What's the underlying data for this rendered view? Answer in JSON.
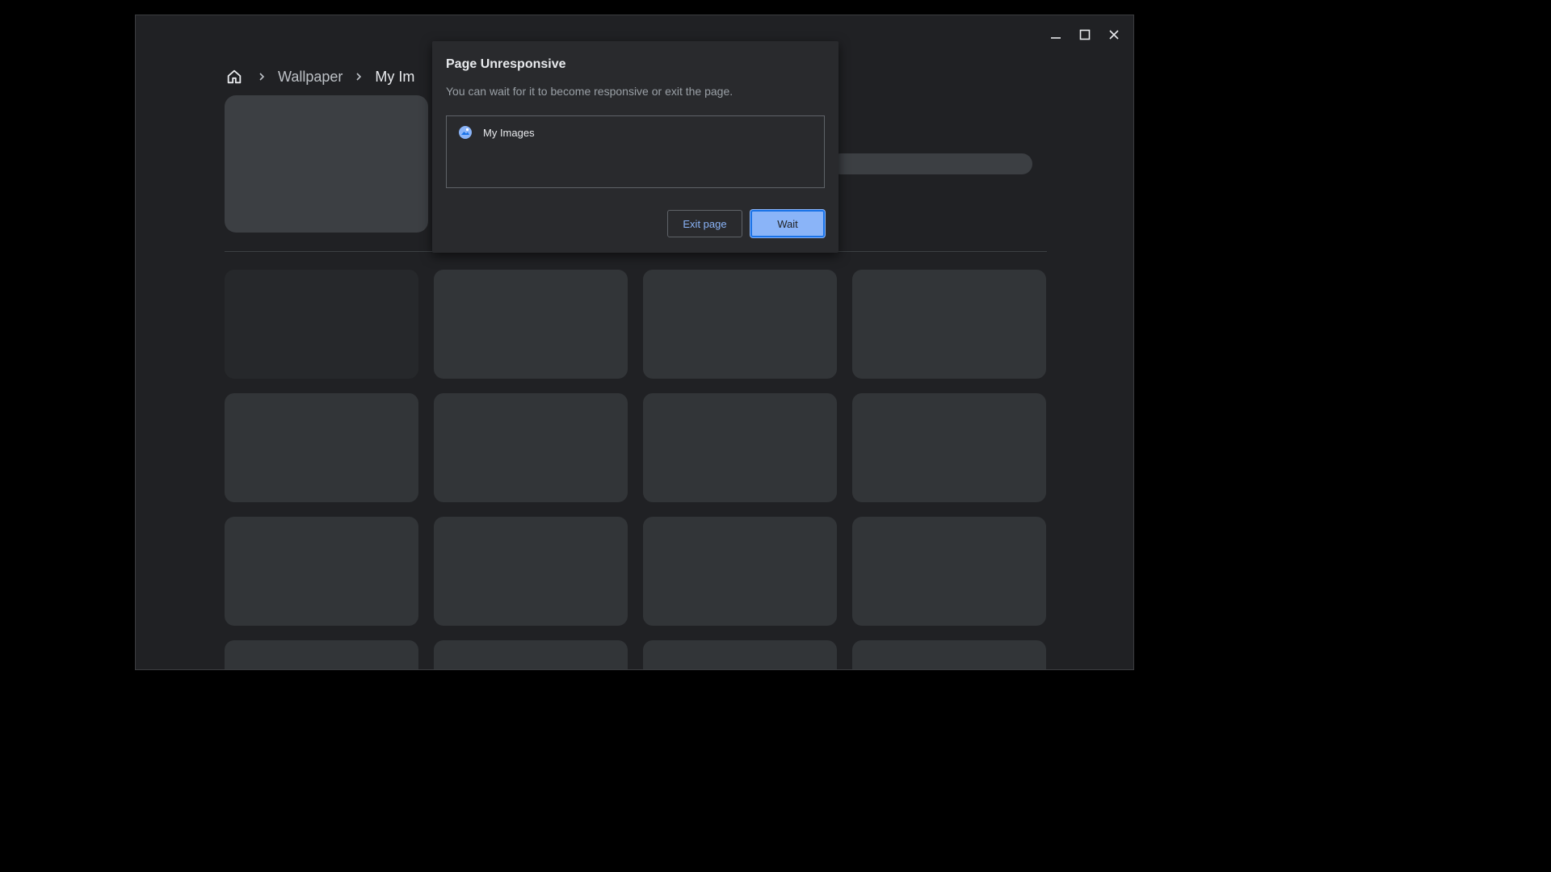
{
  "window": {
    "controls": [
      {
        "icon": "minimize-icon"
      },
      {
        "icon": "maximize-icon"
      },
      {
        "icon": "close-icon"
      }
    ]
  },
  "breadcrumb": {
    "home_icon": "home-icon",
    "separator_icon": "chevron-right-icon",
    "wallpaper_label": "Wallpaper",
    "current_label": "My Im"
  },
  "dialog": {
    "title": "Page Unresponsive",
    "message": "You can wait for it to become responsive or exit the page.",
    "pages": [
      {
        "label": "My Images",
        "icon": "page-favicon-icon"
      }
    ],
    "exit_label": "Exit page",
    "wait_label": "Wait"
  },
  "colors": {
    "accent": "#8ab4f8",
    "window_bg": "#202124",
    "tile_bg": "#323538"
  }
}
